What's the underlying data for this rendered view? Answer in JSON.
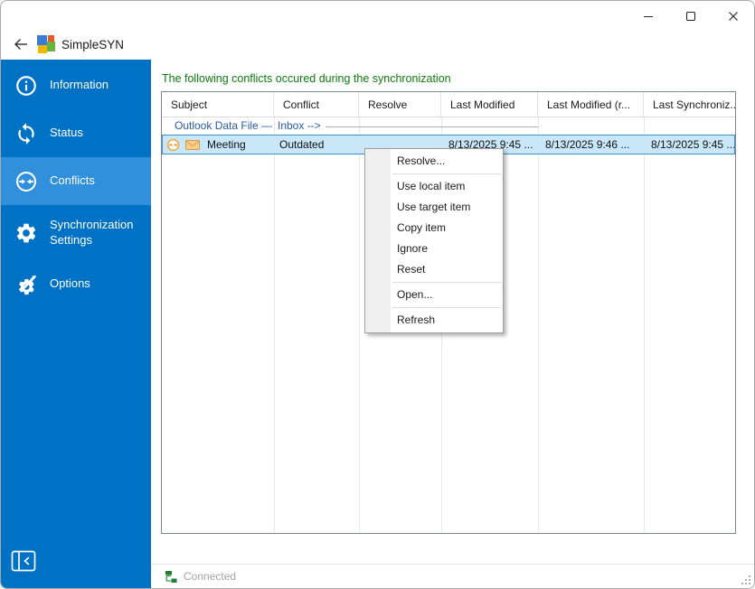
{
  "window": {
    "title": "SimpleSYN",
    "controls": {
      "minimize": "minimize",
      "maximize": "maximize",
      "close": "close"
    }
  },
  "sidebar": {
    "selected": "Conflicts",
    "items": [
      {
        "label": "Information",
        "icon": "info-icon"
      },
      {
        "label": "Status",
        "icon": "sync-icon"
      },
      {
        "label": "Conflicts",
        "icon": "conflict-arrows-icon"
      },
      {
        "label": "Synchronization Settings",
        "icon": "gear-icon"
      },
      {
        "label": "Options",
        "icon": "gear-wrench-icon"
      }
    ]
  },
  "main": {
    "heading": "The following conflicts occured during the synchronization",
    "table": {
      "columns": [
        "Subject",
        "Conflict",
        "Resolve",
        "Last Modified",
        "Last Modified (r...",
        "Last Synchroniz..."
      ],
      "group_row": {
        "subject": "Outlook Data File —",
        "target": "Inbox -->"
      },
      "rows": [
        {
          "subject": "Meeting",
          "conflict": "Outdated",
          "resolve": "",
          "last_modified": "8/13/2025 9:45 ...",
          "last_modified_remote": "8/13/2025 9:46 ...",
          "last_synchronized": "8/13/2025 9:45 ...",
          "selected": true,
          "icons": [
            "conflict-arrows-icon",
            "envelope-icon"
          ]
        }
      ]
    },
    "context_menu": {
      "items": [
        {
          "label": "Resolve..."
        },
        {
          "label": "Use local item"
        },
        {
          "label": "Use target item"
        },
        {
          "label": "Copy item"
        },
        {
          "label": "Ignore"
        },
        {
          "label": "Reset"
        },
        {
          "label": "Open..."
        },
        {
          "label": "Refresh"
        }
      ]
    }
  },
  "statusbar": {
    "status": "Connected"
  },
  "colors": {
    "sidebar_blue": "#0072C6",
    "sidebar_selected_blue": "#3090DB",
    "heading_green": "#0E7C0E",
    "group_row_blue": "#2B5AA8",
    "selected_row_bg": "#C9E7F8",
    "selected_row_border": "#3A92CC",
    "conflict_icon_orange": "#F0A030",
    "connected_green": "#1E7E34"
  }
}
